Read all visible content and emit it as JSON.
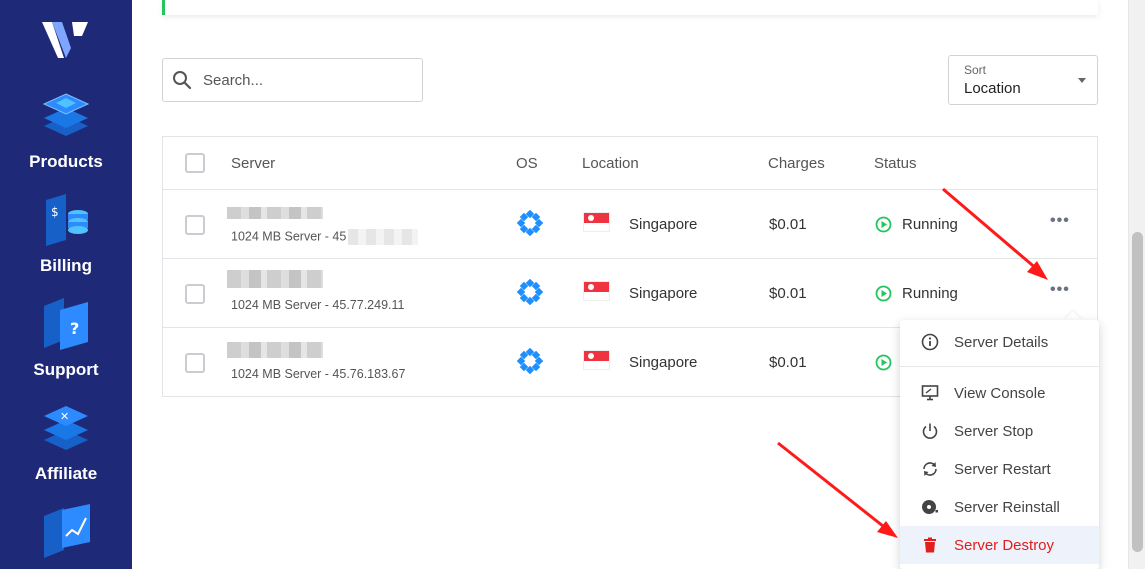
{
  "sidebar": {
    "items": [
      {
        "label": "Products",
        "icon": "layers-icon"
      },
      {
        "label": "Billing",
        "icon": "billing-icon"
      },
      {
        "label": "Support",
        "icon": "support-icon"
      },
      {
        "label": "Affiliate",
        "icon": "affiliate-icon"
      },
      {
        "label": "",
        "icon": "analytics-icon"
      }
    ]
  },
  "search": {
    "placeholder": "Search..."
  },
  "sort": {
    "label": "Sort",
    "value": "Location"
  },
  "table": {
    "headers": {
      "server": "Server",
      "os": "OS",
      "location": "Location",
      "charges": "Charges",
      "status": "Status"
    },
    "rows": [
      {
        "subtitle": "1024 MB Server - 45",
        "location": "Singapore",
        "charges": "$0.01",
        "status": "Running"
      },
      {
        "subtitle": "1024 MB Server - 45.77.249.11",
        "location": "Singapore",
        "charges": "$0.01",
        "status": "Running"
      },
      {
        "subtitle": "1024 MB Server - 45.76.183.67",
        "location": "Singapore",
        "charges": "$0.01",
        "status": ""
      }
    ],
    "more_label": "•••"
  },
  "menu": {
    "items": [
      {
        "label": "Server Details",
        "icon": "info-icon"
      },
      {
        "label": "View Console",
        "icon": "monitor-icon"
      },
      {
        "label": "Server Stop",
        "icon": "power-icon"
      },
      {
        "label": "Server Restart",
        "icon": "restart-icon"
      },
      {
        "label": "Server Reinstall",
        "icon": "reinstall-icon"
      },
      {
        "label": "Server Destroy",
        "icon": "trash-icon"
      }
    ]
  },
  "colors": {
    "sidebar_bg": "#1e2a78",
    "accent_blue": "#1f8fff",
    "running_green": "#22c55e",
    "danger_red": "#e11d1d",
    "annotation_arrow": "#ff1a1a"
  }
}
